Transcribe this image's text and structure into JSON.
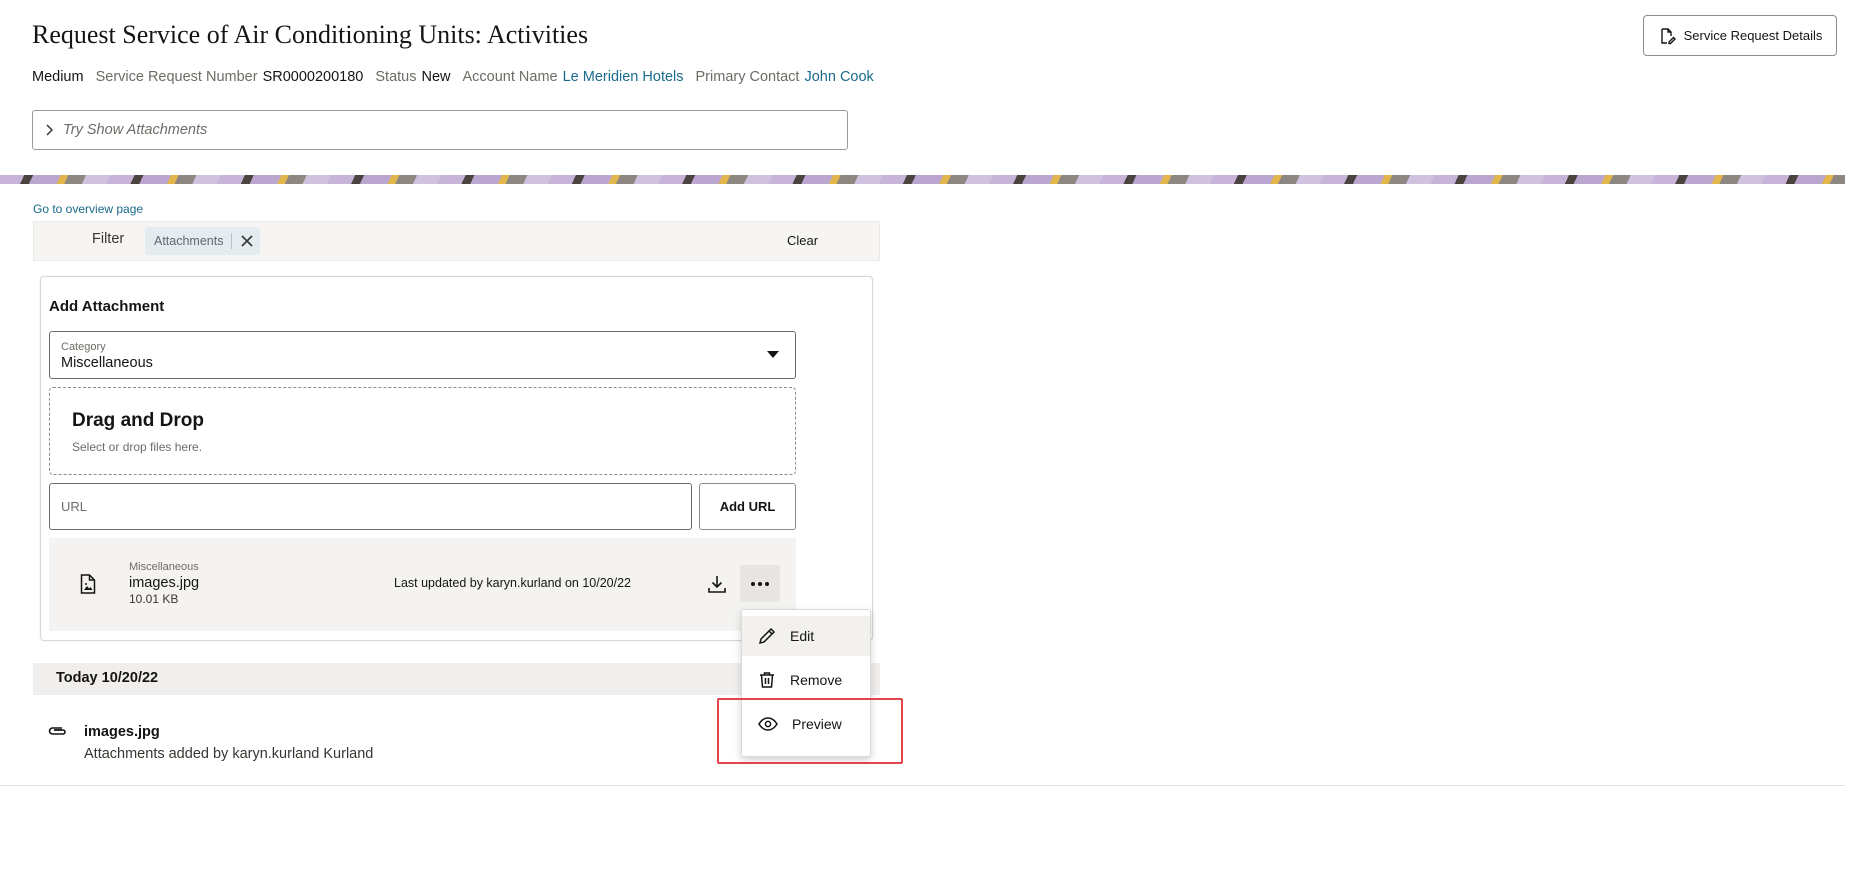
{
  "header": {
    "title": "Request Service of Air Conditioning Units: Activities",
    "priority": "Medium",
    "sr_number_label": "Service Request Number",
    "sr_number": "SR0000200180",
    "status_label": "Status",
    "status": "New",
    "account_label": "Account Name",
    "account": "Le Meridien Hotels",
    "contact_label": "Primary Contact",
    "contact": "John Cook",
    "details_button": "Service Request Details"
  },
  "attachments_toggle": {
    "label": "Try Show Attachments",
    "icon": "chevron-right-icon"
  },
  "nav": {
    "overview_link": "Go to overview page"
  },
  "filter": {
    "label": "Filter",
    "chip": "Attachments",
    "clear": "Clear"
  },
  "add_attachment": {
    "title": "Add Attachment",
    "category_label": "Category",
    "category_value": "Miscellaneous",
    "dropzone_title": "Drag and Drop",
    "dropzone_subtitle": "Select or drop files here.",
    "url_placeholder": "URL",
    "add_url_button": "Add URL"
  },
  "file": {
    "category": "Miscellaneous",
    "name": "images.jpg",
    "size": "10.01 KB",
    "updated": "Last updated by karyn.kurland on 10/20/22"
  },
  "context_menu": {
    "items": [
      {
        "label": "Edit",
        "icon": "pencil-icon"
      },
      {
        "label": "Remove",
        "icon": "trash-icon"
      },
      {
        "label": "Preview",
        "icon": "eye-icon"
      }
    ],
    "highlight_color": "#e0474c"
  },
  "activity": {
    "date_header": "Today 10/20/22",
    "title": "images.jpg",
    "description": "Attachments added by karyn.kurland Kurland",
    "icon": "paperclip-icon"
  },
  "colors": {
    "link": "#1a6a8a",
    "text": "#161513",
    "muted": "#6f6b66"
  }
}
